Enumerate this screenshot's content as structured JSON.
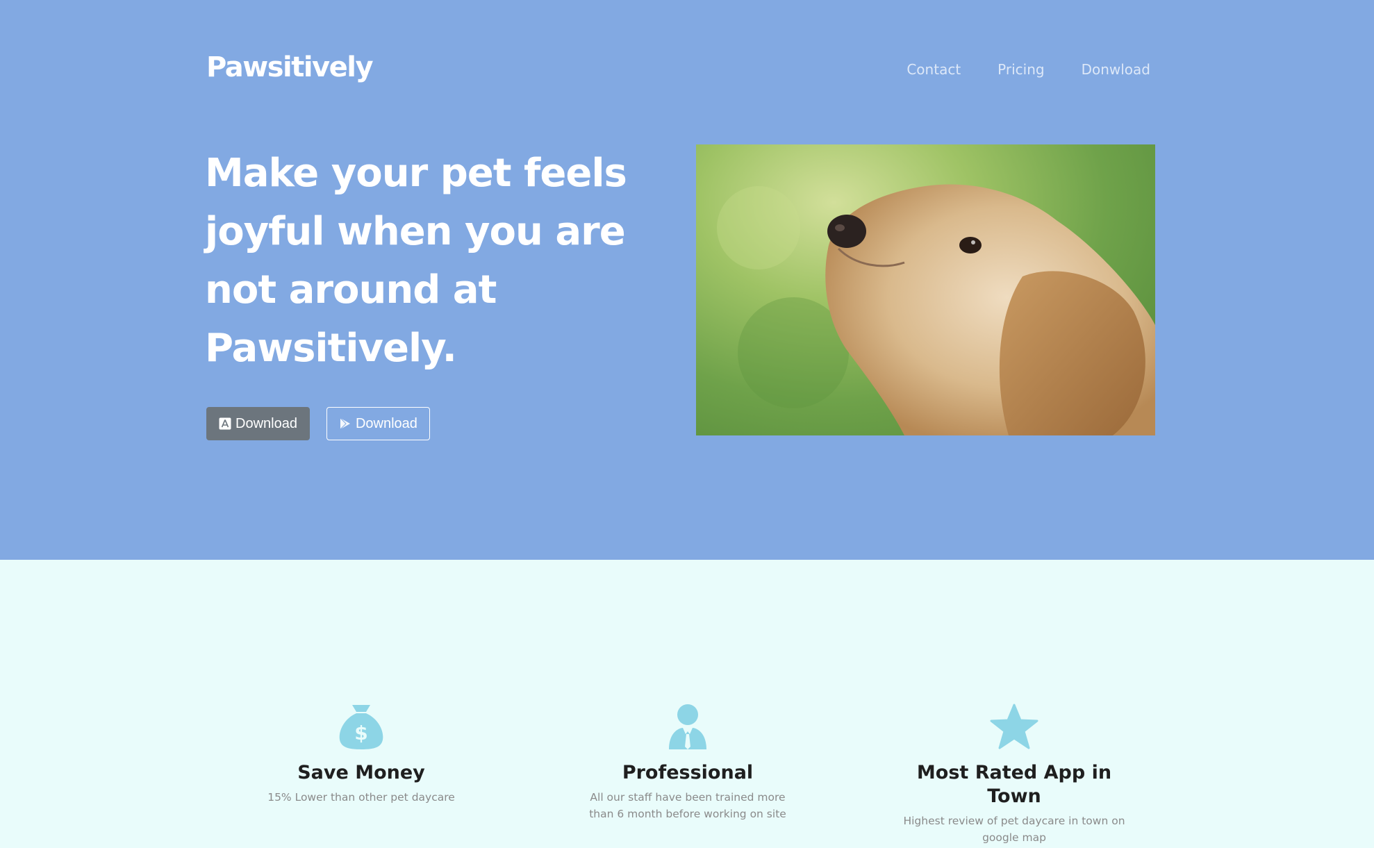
{
  "header": {
    "brand": "Pawsitively",
    "nav": [
      {
        "label": "Contact"
      },
      {
        "label": "Pricing"
      },
      {
        "label": "Donwload"
      }
    ]
  },
  "hero": {
    "headline": "Make your pet feels joyful when you are not around at Pawsitively.",
    "buttons": [
      {
        "label": "Download",
        "icon": "app-store-icon"
      },
      {
        "label": "Download",
        "icon": "google-play-icon"
      }
    ],
    "image_alt": "golden retriever puppy looking up"
  },
  "features": [
    {
      "icon": "money-bag-icon",
      "title": "Save Money",
      "text": "15% Lower than other pet daycare"
    },
    {
      "icon": "staff-person-icon",
      "title": "Professional",
      "text": "All our staff have been trained more than 6 month before working on site"
    },
    {
      "icon": "star-icon",
      "title": "Most Rated App in Town",
      "text": "Highest review of pet daycare in town on google map"
    }
  ],
  "colors": {
    "hero_bg": "#82a9e2",
    "features_bg": "#e9fcfb",
    "icon": "#8dd5e6",
    "dark_button": "#6c757d"
  }
}
